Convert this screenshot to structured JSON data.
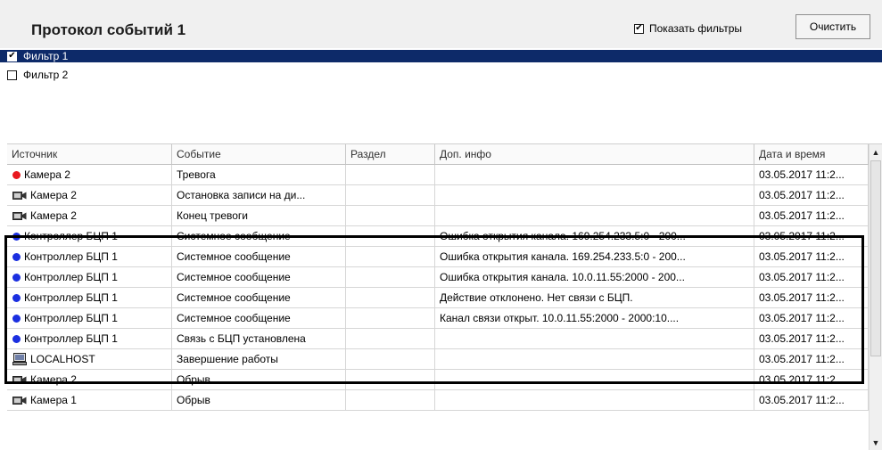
{
  "header": {
    "title": "Протокол событий 1",
    "show_filters_label": "Показать фильтры",
    "show_filters_checked": true,
    "clear_label": "Очистить"
  },
  "filters": [
    {
      "label": "Фильтр 1",
      "checked": true,
      "selected": true
    },
    {
      "label": "Фильтр 2",
      "checked": false,
      "selected": false
    }
  ],
  "table": {
    "columns": [
      "Источник",
      "Событие",
      "Раздел",
      "Доп. инфо",
      "Дата и время"
    ],
    "rows": [
      {
        "icon": "red-dot-icon",
        "source": "Камера 2",
        "event": "Тревога",
        "section": "",
        "info": "",
        "datetime": "03.05.2017 11:2..."
      },
      {
        "icon": "camera-icon",
        "source": "Камера 2",
        "event": "Остановка записи на ди...",
        "section": "",
        "info": "",
        "datetime": "03.05.2017 11:2..."
      },
      {
        "icon": "camera-icon",
        "source": "Камера 2",
        "event": "Конец тревоги",
        "section": "",
        "info": "",
        "datetime": "03.05.2017 11:2..."
      },
      {
        "icon": "blue-dot-icon",
        "source": "Контроллер БЦП 1",
        "event": "Системное сообщение",
        "section": "",
        "info": "Ошибка открытия канала. 169.254.233.5:0 - 200...",
        "datetime": "03.05.2017 11:2..."
      },
      {
        "icon": "blue-dot-icon",
        "source": "Контроллер БЦП 1",
        "event": "Системное сообщение",
        "section": "",
        "info": "Ошибка открытия канала. 169.254.233.5:0 - 200...",
        "datetime": "03.05.2017 11:2..."
      },
      {
        "icon": "blue-dot-icon",
        "source": "Контроллер БЦП 1",
        "event": "Системное сообщение",
        "section": "",
        "info": "Ошибка открытия канала. 10.0.11.55:2000 - 200...",
        "datetime": "03.05.2017 11:2..."
      },
      {
        "icon": "blue-dot-icon",
        "source": "Контроллер БЦП 1",
        "event": "Системное сообщение",
        "section": "",
        "info": "Действие отклонено. Нет связи с БЦП.",
        "datetime": "03.05.2017 11:2..."
      },
      {
        "icon": "blue-dot-icon",
        "source": "Контроллер БЦП 1",
        "event": "Системное сообщение",
        "section": "",
        "info": "Канал связи открыт. 10.0.11.55:2000 - 2000:10....",
        "datetime": "03.05.2017 11:2..."
      },
      {
        "icon": "blue-dot-icon",
        "source": "Контроллер БЦП 1",
        "event": "Связь с БЦП установлена",
        "section": "",
        "info": "",
        "datetime": "03.05.2017 11:2..."
      },
      {
        "icon": "computer-icon",
        "source": "LOCALHOST",
        "event": "Завершение работы",
        "section": "",
        "info": "",
        "datetime": "03.05.2017 11:2..."
      },
      {
        "icon": "camera-icon",
        "source": "Камера 2",
        "event": "Обрыв",
        "section": "",
        "info": "",
        "datetime": "03.05.2017 11:2..."
      },
      {
        "icon": "camera-icon",
        "source": "Камера 1",
        "event": "Обрыв",
        "section": "",
        "info": "",
        "datetime": "03.05.2017 11:2..."
      }
    ]
  },
  "colors": {
    "selection": "#0d2a69",
    "red_dot": "#e8191f",
    "blue_dot": "#1b2fe0",
    "highlight_border": "#000000"
  }
}
